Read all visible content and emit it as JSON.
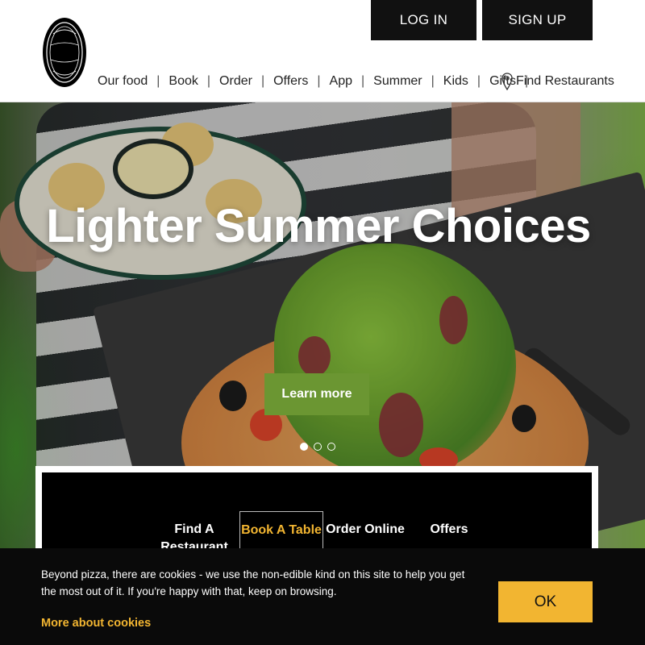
{
  "header": {
    "logo_text": "PIZZA EXPRESS",
    "login_label": "LOG IN",
    "signup_label": "SIGN UP",
    "nav": [
      {
        "label": "Our food"
      },
      {
        "label": "Book"
      },
      {
        "label": "Order"
      },
      {
        "label": "Offers"
      },
      {
        "label": "App"
      },
      {
        "label": "Summer"
      },
      {
        "label": "Kids"
      },
      {
        "label": "Gifts"
      }
    ],
    "find_restaurants_label": "Find Restaurants",
    "find_restaurants_icon": "location-pin-icon"
  },
  "hero": {
    "title": "Lighter Summer Choices",
    "cta_label": "Learn more",
    "slides_total": 3,
    "active_slide": 1
  },
  "quick_links": [
    {
      "label": "Find A Restaurant"
    },
    {
      "label": "Book A Table"
    },
    {
      "label": "Order Online"
    },
    {
      "label": "Offers"
    }
  ],
  "cookie_bar": {
    "message": "Beyond pizza, there are cookies - we use the non-edible kind on this site to help you get the most out of it. If you're happy with that, keep on browsing.",
    "more_link": "More about cookies",
    "ok_label": "OK"
  },
  "colors": {
    "black": "#111111",
    "gold": "#f2b531",
    "green": "#6b9632"
  }
}
